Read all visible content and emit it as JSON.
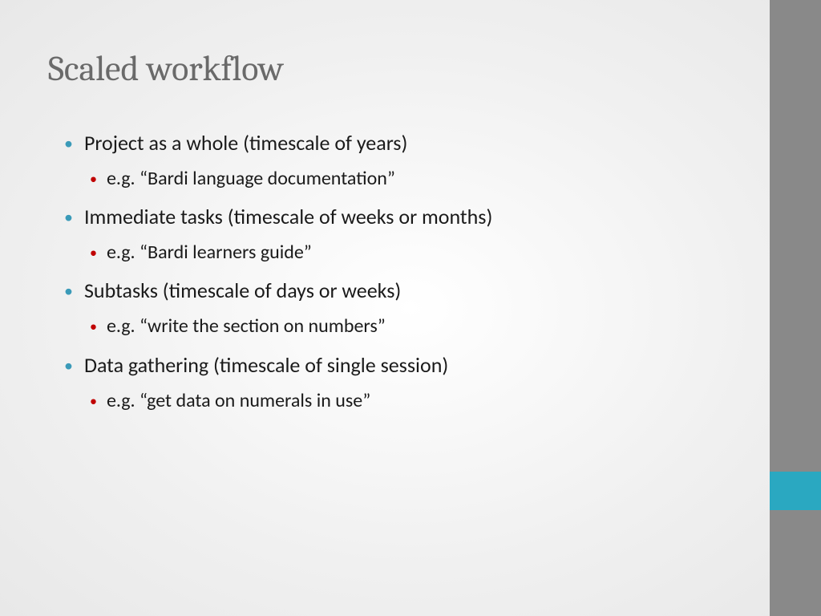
{
  "title": "Scaled workflow",
  "bullets": [
    {
      "main": "Project as a whole (timescale of years)",
      "sub": "e.g. “Bardi language documentation”"
    },
    {
      "main": "Immediate tasks (timescale of weeks or months)",
      "sub": "e.g. “Bardi learners guide”"
    },
    {
      "main": "Subtasks (timescale of days or weeks)",
      "sub": "e.g. “write the section on numbers”"
    },
    {
      "main": "Data gathering (timescale of single session)",
      "sub": "e.g. “get data on numerals in use”"
    }
  ]
}
